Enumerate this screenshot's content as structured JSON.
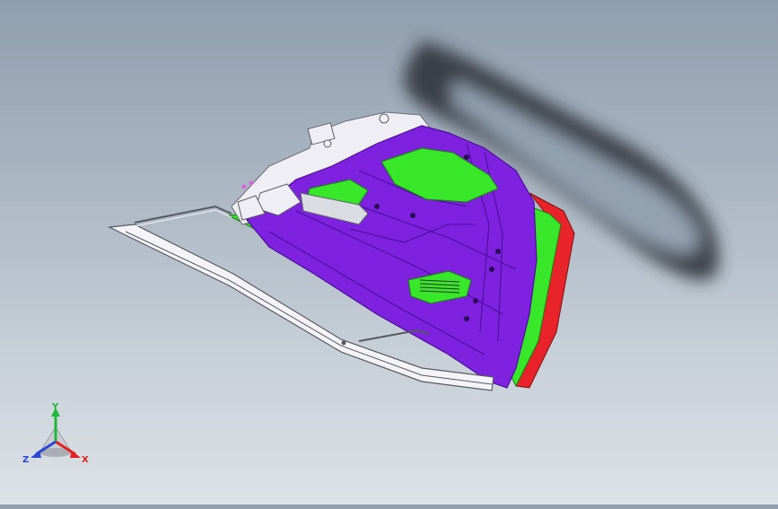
{
  "viewport": {
    "background_top": "#8f9eae",
    "background_bottom": "#dde2e7",
    "model_colors": {
      "inner_panel": "#7f22e0",
      "panel_edge": "#4a0f9a",
      "green_cutout": "#38e62a",
      "white_hardware": "#eeeef4",
      "red_edge": "#e8232a",
      "shadow": "#2b2f35"
    }
  },
  "triad": {
    "x_label": "X",
    "y_label": "Y",
    "z_label": "Z",
    "x_color": "#e41e1e",
    "y_color": "#1fb83a",
    "z_color": "#2a47d6"
  }
}
